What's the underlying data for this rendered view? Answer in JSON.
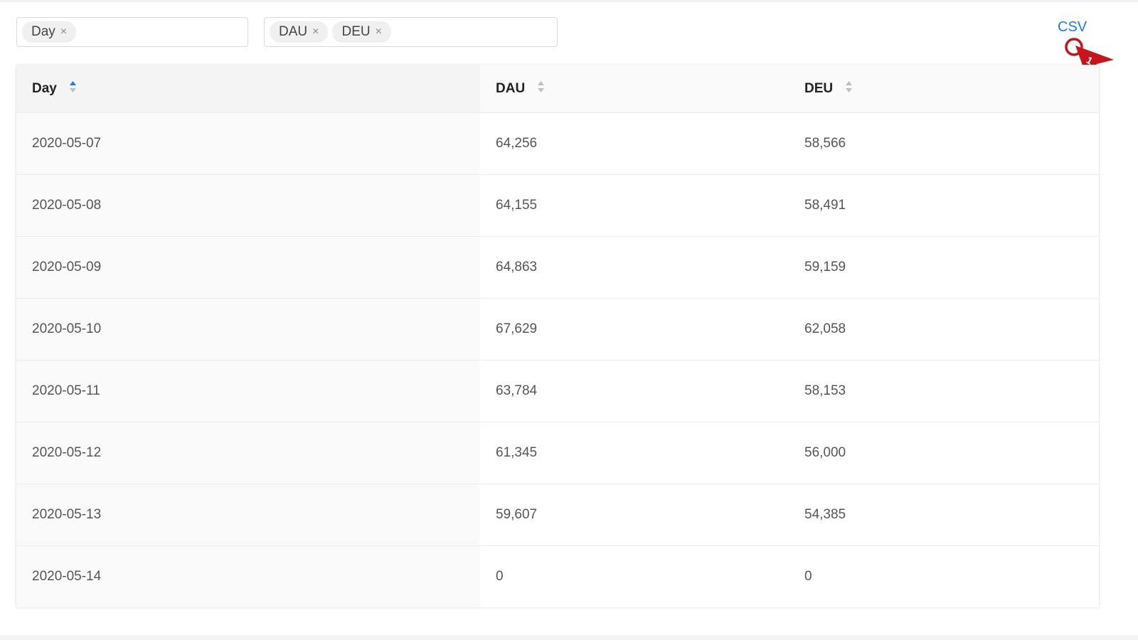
{
  "filters": {
    "dimension_tags": [
      "Day"
    ],
    "metric_tags": [
      "DAU",
      "DEU"
    ],
    "remove_glyph": "×"
  },
  "export": {
    "csv_label": "CSV"
  },
  "table": {
    "columns": [
      "Day",
      "DAU",
      "DEU"
    ],
    "sorted_column": "Day",
    "sort_direction": "ascending",
    "rows": [
      [
        "2020-05-07",
        "64,256",
        "58,566"
      ],
      [
        "2020-05-08",
        "64,155",
        "58,491"
      ],
      [
        "2020-05-09",
        "64,863",
        "59,159"
      ],
      [
        "2020-05-10",
        "67,629",
        "62,058"
      ],
      [
        "2020-05-11",
        "63,784",
        "58,153"
      ],
      [
        "2020-05-12",
        "61,345",
        "56,000"
      ],
      [
        "2020-05-13",
        "59,607",
        "54,385"
      ],
      [
        "2020-05-14",
        "0",
        "0"
      ]
    ]
  },
  "colors": {
    "accent": "#1a7cf0",
    "cursor": "#c8151b",
    "sort_inactive": "#bfbfbf"
  },
  "cursor": {
    "badge": "1"
  }
}
